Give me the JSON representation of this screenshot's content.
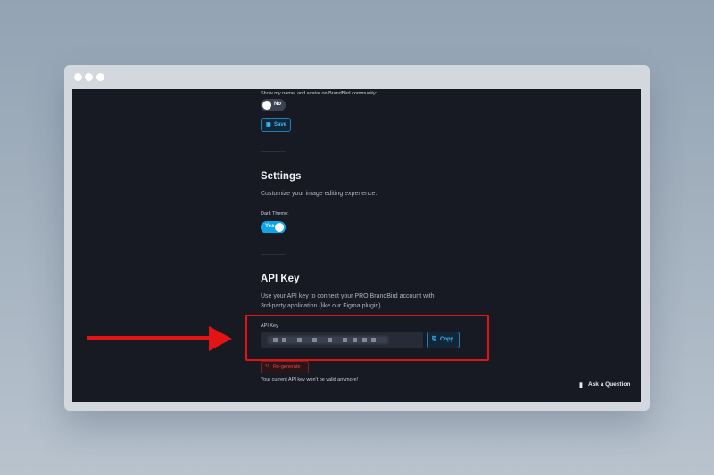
{
  "community": {
    "label": "Show my name, and avatar on BrandBird community:",
    "toggle_text": "No",
    "save_label": "Save",
    "save_icon": "save-icon"
  },
  "settings": {
    "title": "Settings",
    "description": "Customize your image editing experience.",
    "dark_theme_label": "Dark Theme:",
    "dark_theme_toggle": "Yes"
  },
  "api": {
    "title": "API Key",
    "description_line1": "Use your API key to connect your PRO BrandBird account with",
    "description_line2": "3rd-party application (like our Figma plugin).",
    "field_label": "API Key",
    "copy_label": "Copy",
    "copy_icon": "clipboard-icon",
    "regenerate_label": "Re-generate",
    "regenerate_icon": "refresh-icon",
    "warning": "Your current API key won't be valid anymore!"
  },
  "help": {
    "ask_label": "Ask a Question",
    "ask_icon": "chat-icon"
  },
  "colors": {
    "accent": "#0ea5e9",
    "annotation_red": "#e21414",
    "background": "#171923"
  }
}
